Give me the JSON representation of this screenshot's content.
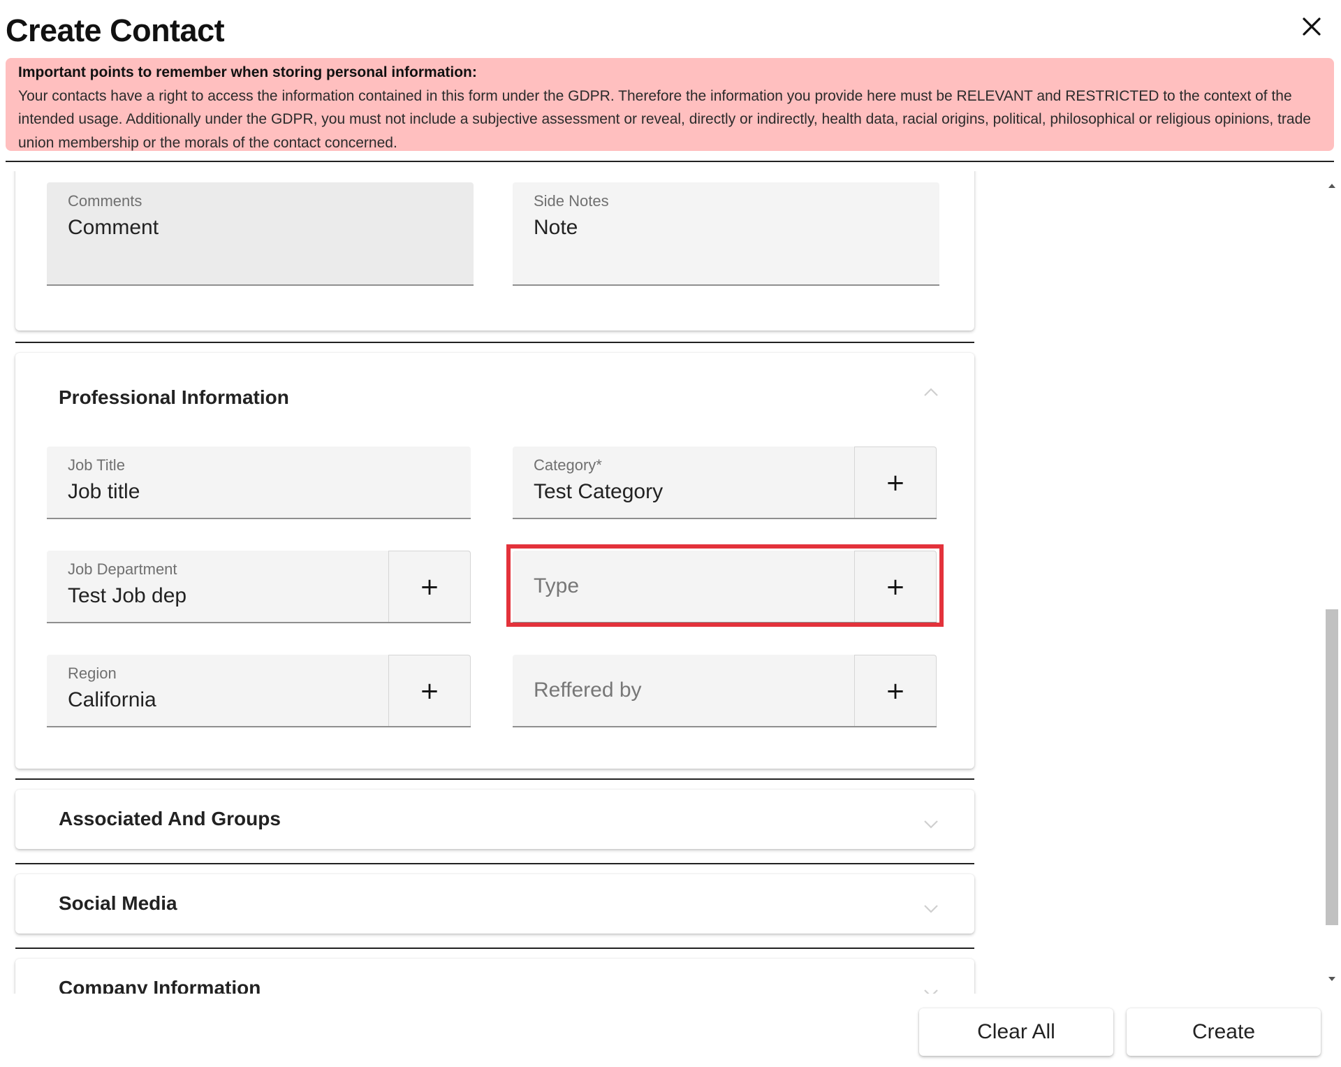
{
  "dialog": {
    "title": "Create Contact"
  },
  "gdpr": {
    "title": "Important points to remember when storing personal information:",
    "body": "Your contacts have a right to access the information contained in this form under the GDPR. Therefore the information you provide here must be RELEVANT and RESTRICTED to the context of the intended usage. Additionally under the GDPR, you must not include a subjective assessment or reveal, directly or indirectly, health data, racial origins, political, philosophical or religious opinions, trade union membership or the morals of the contact concerned."
  },
  "notes_section": {
    "comments": {
      "label": "Comments",
      "value": "Comment"
    },
    "side_notes": {
      "label": "Side Notes",
      "value": "Note"
    }
  },
  "professional": {
    "title": "Professional Information",
    "job_title": {
      "label": "Job Title",
      "value": "Job title"
    },
    "category": {
      "label": "Category*",
      "value": "Test Category"
    },
    "job_department": {
      "label": "Job Department",
      "value": "Test Job dep"
    },
    "type": {
      "placeholder": "Type"
    },
    "region": {
      "label": "Region",
      "value": "California"
    },
    "referred_by": {
      "placeholder": "Reffered by"
    },
    "add_symbol": "+"
  },
  "sections": {
    "associated": "Associated And Groups",
    "social": "Social Media",
    "company": "Company Information"
  },
  "footer": {
    "clear_all": "Clear All",
    "create": "Create"
  },
  "colors": {
    "gdpr_background": "#ffbfbf",
    "highlight": "#e3323b"
  }
}
